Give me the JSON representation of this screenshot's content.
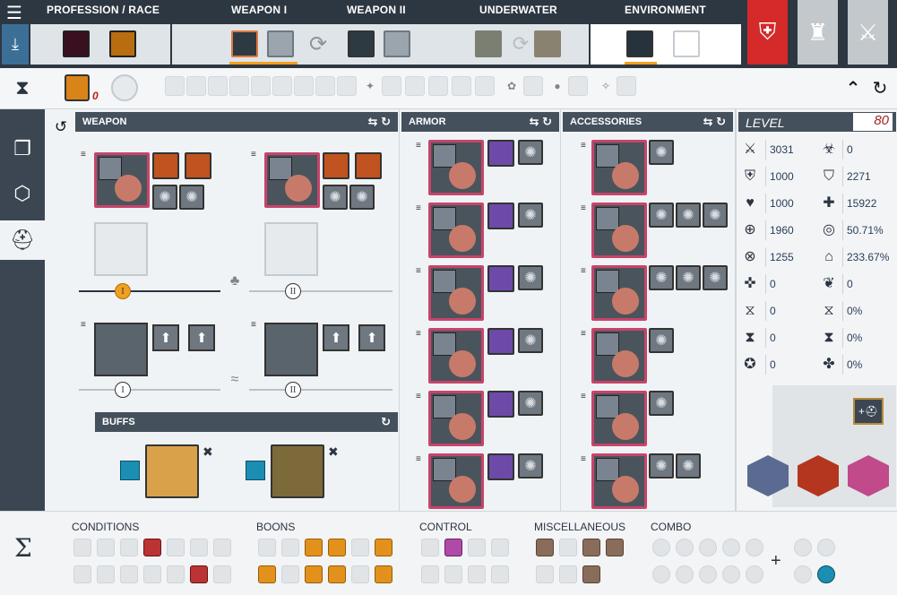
{
  "top": {
    "profession_race": "PROFESSION / RACE",
    "weapon1": "WEAPON I",
    "weapon2": "WEAPON II",
    "underwater": "UNDERWATER",
    "environment": "ENVIRONMENT"
  },
  "weapon_panel": {
    "title": "WEAPON",
    "set1_label": "I",
    "set2_label": "II",
    "aqua1_label": "I",
    "aqua2_label": "II",
    "buffs_title": "BUFFS"
  },
  "armor_panel": {
    "title": "ARMOR"
  },
  "accessories_panel": {
    "title": "ACCESSORIES"
  },
  "row2": {
    "counter": "0"
  },
  "stats": {
    "level_label": "LEVEL",
    "level_value": "80",
    "left": [
      "3031",
      "1000",
      "1000",
      "1960",
      "1255",
      "0",
      "0",
      "0",
      "0"
    ],
    "right": [
      "0",
      "2271",
      "15922",
      "50.71%",
      "233.67%",
      "0",
      "0%",
      "0%",
      "0%"
    ]
  },
  "bottom": {
    "conditions": "CONDITIONS",
    "boons": "BOONS",
    "control": "CONTROL",
    "misc": "MISCELLANEOUS",
    "combo": "COMBO",
    "sigma": "Σ",
    "plus": "+"
  },
  "colors": {
    "accent": "#f0a020",
    "gear_border": "#c8446a",
    "header": "#44505c",
    "level": "#9c1f1f"
  }
}
